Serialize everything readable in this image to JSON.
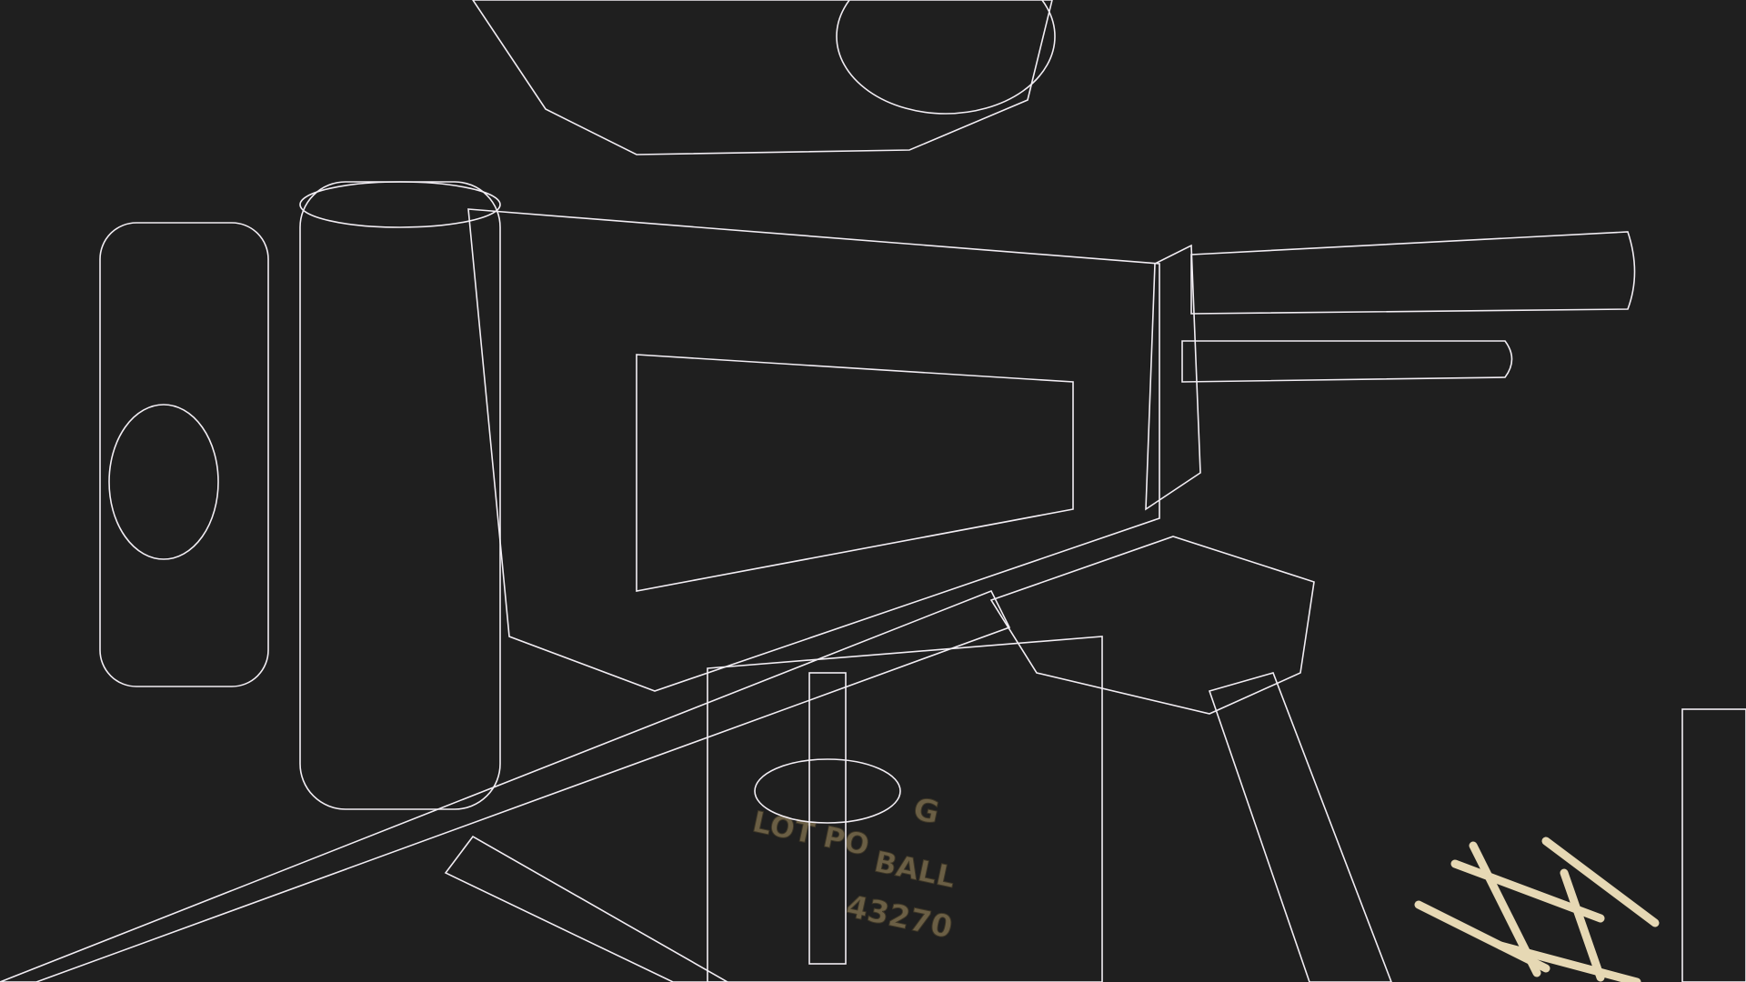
{
  "scene": {
    "subject": "wireframe-machine-gun-render",
    "background_color": "#1f1f1f",
    "wire_color": "#f2eef4",
    "ammo_box_color": "#7a6c4e"
  },
  "ammo_box_markings": {
    "line1": "G",
    "line2_left": "LOT PO",
    "line2_right": "BALL",
    "line3": "43270"
  }
}
